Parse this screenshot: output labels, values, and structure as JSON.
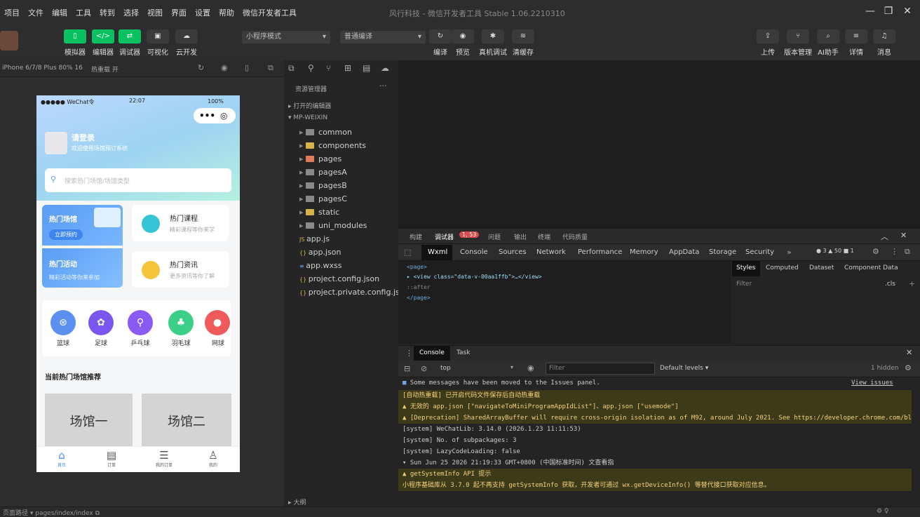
{
  "menubar": {
    "items": [
      "项目",
      "文件",
      "编辑",
      "工具",
      "转到",
      "选择",
      "视图",
      "界面",
      "设置",
      "帮助",
      "微信开发者工具"
    ],
    "title": "风行科技 - 微信开发者工具 Stable 1.06.2210310"
  },
  "toolbar": {
    "left": [
      "模拟器",
      "编辑器",
      "调试器",
      "可视化",
      "云开发"
    ],
    "mode_select": "小程序模式",
    "compile_select": "普通编译",
    "mid": [
      "编译",
      "预览",
      "真机调试",
      "清缓存"
    ],
    "right": [
      "上传",
      "版本管理",
      "AI助手",
      "详情",
      "消息"
    ]
  },
  "simulator": {
    "device": "iPhone 6/7/8 Plus 80% 16",
    "hot_reload": "热重载 开"
  },
  "phone": {
    "carrier": "●●●●● WeChat令",
    "time": "22:07",
    "battery": "100%",
    "login_title": "请登录",
    "login_sub": "欢迎使用场馆预订系统",
    "search_placeholder": "搜索热门场馆/场馆类型",
    "promo1_title": "热门场馆",
    "promo1_btn": "立即预约",
    "promo2_title": "热门活动",
    "promo2_sub": "精彩活动等你来参加",
    "card1_title": "热门课程",
    "card1_sub": "精彩课程等你来学",
    "card2_title": "热门资讯",
    "card2_sub": "更多资讯等你了解",
    "sports": [
      "篮球",
      "足球",
      "乒乓球",
      "羽毛球",
      "网球"
    ],
    "section_title": "当前热门场馆推荐",
    "venue1": "场馆一",
    "venue2": "场馆二",
    "tabs": [
      "首页",
      "订单",
      "我的订单",
      "我的"
    ]
  },
  "explorer": {
    "header": "资源管理器",
    "open_editors": "打开的编辑器",
    "project": "MP-WEIXIN",
    "items": [
      "common",
      "components",
      "pages",
      "pagesA",
      "pagesB",
      "pagesC",
      "static",
      "uni_modules",
      "app.js",
      "app.json",
      "app.wxss",
      "project.config.json",
      "project.private.config.js..."
    ],
    "outline": "大纲"
  },
  "debug": {
    "panel_tabs": [
      "构建",
      "调试器",
      "问题",
      "输出",
      "终端",
      "代码质量"
    ],
    "badge": "1, 53",
    "dev_tabs": [
      "Wxml",
      "Console",
      "Sources",
      "Network",
      "Performance",
      "Memory",
      "AppData",
      "Storage",
      "Security"
    ],
    "status_counts": "● 3 ▲ 50 ■ 1",
    "style_tabs": [
      "Styles",
      "Computed",
      "Dataset",
      "Component Data"
    ],
    "filter_label": "Filter",
    "cls_label": ".cls",
    "wxml_lines": [
      "<page>",
      "▸ <view class=\"data-v-00aa1ffb\">…</view>",
      "  ::after",
      "</page>"
    ],
    "console_tabs": [
      "Console",
      "Task"
    ],
    "context": "top",
    "console_filter": "Filter",
    "levels": "Default levels ▾",
    "hidden": "1 hidden",
    "msg_moved": "Some messages have been moved to the Issues panel.",
    "view_issues": "View issues",
    "logs": [
      {
        "type": "warn",
        "text": "[自动热重载] 已开启代码文件保存后自动热重载"
      },
      {
        "type": "warn",
        "text": "▲ 无效的 app.json [\"navigateToMiniProgramAppIdList\"]、app.json [\"usemode\"]"
      },
      {
        "type": "warn",
        "text": "▲ [Deprecation] SharedArrayBuffer will require cross-origin isolation as of M92, around July 2021. See https://developer.chrome.com/blog/enabling-shared-array-buffer/ for more details."
      },
      {
        "type": "info",
        "text": "[system] WeChatLib: 3.14.0 (2026.1.23 11:11:53)"
      },
      {
        "type": "info",
        "text": "[system] No. of subpackages: 3"
      },
      {
        "type": "info",
        "text": "[system] LazyCodeLoading: false"
      },
      {
        "type": "info",
        "text": "▾ Sun Jun 25 2026 21:19:33 GMT+0800 (中国标准时间) 文查看指"
      },
      {
        "type": "warn",
        "text": "▲ getSystemInfo API 提示"
      },
      {
        "type": "warn",
        "text": "小程序基础库从 3.7.0 起不再支持 getSystemInfo 获取，开发者可通过 wx.getDeviceInfo() 等替代接口获取对应信息。"
      }
    ]
  },
  "status": {
    "left": "页面路径 ▾  pages/index/index  ⧉",
    "right": "⚙ ♀"
  }
}
